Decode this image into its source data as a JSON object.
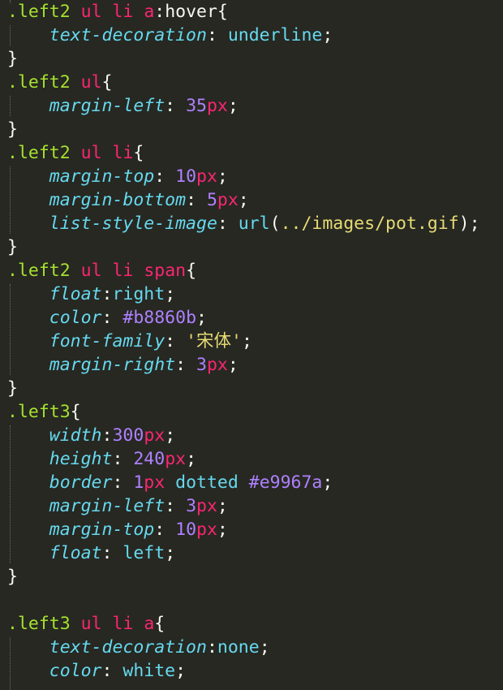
{
  "editor": {
    "colors": {
      "background": "#272822",
      "selector": "#a6e22e",
      "tag": "#f92672",
      "property": "#66d9ef",
      "number": "#ae81ff",
      "unit": "#f92672",
      "string": "#e6db74",
      "plain": "#f8f8f2"
    },
    "lines": [
      [
        [
          "sel",
          ".left2"
        ],
        [
          "plain",
          " "
        ],
        [
          "tag",
          "ul"
        ],
        [
          "plain",
          " "
        ],
        [
          "tag",
          "li"
        ],
        [
          "plain",
          " "
        ],
        [
          "tag",
          "a"
        ],
        [
          "plain",
          ":hover{"
        ]
      ],
      [
        [
          "plain",
          "    "
        ],
        [
          "prop",
          "text-decoration"
        ],
        [
          "plain",
          ": "
        ],
        [
          "val",
          "underline"
        ],
        [
          "plain",
          ";"
        ]
      ],
      [
        [
          "plain",
          "}"
        ]
      ],
      [
        [
          "sel",
          ".left2"
        ],
        [
          "plain",
          " "
        ],
        [
          "tag",
          "ul"
        ],
        [
          "plain",
          "{"
        ]
      ],
      [
        [
          "plain",
          "    "
        ],
        [
          "prop",
          "margin-left"
        ],
        [
          "plain",
          ": "
        ],
        [
          "num",
          "35"
        ],
        [
          "unit",
          "px"
        ],
        [
          "plain",
          ";"
        ]
      ],
      [
        [
          "plain",
          "}"
        ]
      ],
      [
        [
          "sel",
          ".left2"
        ],
        [
          "plain",
          " "
        ],
        [
          "tag",
          "ul"
        ],
        [
          "plain",
          " "
        ],
        [
          "tag",
          "li"
        ],
        [
          "plain",
          "{"
        ]
      ],
      [
        [
          "plain",
          "    "
        ],
        [
          "prop",
          "margin-top"
        ],
        [
          "plain",
          ": "
        ],
        [
          "num",
          "10"
        ],
        [
          "unit",
          "px"
        ],
        [
          "plain",
          ";"
        ]
      ],
      [
        [
          "plain",
          "    "
        ],
        [
          "prop",
          "margin-bottom"
        ],
        [
          "plain",
          ": "
        ],
        [
          "num",
          "5"
        ],
        [
          "unit",
          "px"
        ],
        [
          "plain",
          ";"
        ]
      ],
      [
        [
          "plain",
          "    "
        ],
        [
          "prop",
          "list-style-image"
        ],
        [
          "plain",
          ": "
        ],
        [
          "val",
          "url"
        ],
        [
          "plain",
          "("
        ],
        [
          "str",
          "../images/pot.gif"
        ],
        [
          "plain",
          ");"
        ]
      ],
      [
        [
          "plain",
          "}"
        ]
      ],
      [
        [
          "sel",
          ".left2"
        ],
        [
          "plain",
          " "
        ],
        [
          "tag",
          "ul"
        ],
        [
          "plain",
          " "
        ],
        [
          "tag",
          "li"
        ],
        [
          "plain",
          " "
        ],
        [
          "tag",
          "span"
        ],
        [
          "plain",
          "{"
        ]
      ],
      [
        [
          "plain",
          "    "
        ],
        [
          "prop",
          "float"
        ],
        [
          "plain",
          ":"
        ],
        [
          "val",
          "right"
        ],
        [
          "plain",
          ";"
        ]
      ],
      [
        [
          "plain",
          "    "
        ],
        [
          "prop",
          "color"
        ],
        [
          "plain",
          ": "
        ],
        [
          "num",
          "#b8860b"
        ],
        [
          "plain",
          ";"
        ]
      ],
      [
        [
          "plain",
          "    "
        ],
        [
          "prop",
          "font-family"
        ],
        [
          "plain",
          ": "
        ],
        [
          "str",
          "'宋体'"
        ],
        [
          "plain",
          ";"
        ]
      ],
      [
        [
          "plain",
          "    "
        ],
        [
          "prop",
          "margin-right"
        ],
        [
          "plain",
          ": "
        ],
        [
          "num",
          "3"
        ],
        [
          "unit",
          "px"
        ],
        [
          "plain",
          ";"
        ]
      ],
      [
        [
          "plain",
          "}"
        ]
      ],
      [
        [
          "sel",
          ".left3"
        ],
        [
          "plain",
          "{"
        ]
      ],
      [
        [
          "plain",
          "    "
        ],
        [
          "prop",
          "width"
        ],
        [
          "plain",
          ":"
        ],
        [
          "num",
          "300"
        ],
        [
          "unit",
          "px"
        ],
        [
          "plain",
          ";"
        ]
      ],
      [
        [
          "plain",
          "    "
        ],
        [
          "prop",
          "height"
        ],
        [
          "plain",
          ": "
        ],
        [
          "num",
          "240"
        ],
        [
          "unit",
          "px"
        ],
        [
          "plain",
          ";"
        ]
      ],
      [
        [
          "plain",
          "    "
        ],
        [
          "prop",
          "border"
        ],
        [
          "plain",
          ": "
        ],
        [
          "num",
          "1"
        ],
        [
          "unit",
          "px"
        ],
        [
          "plain",
          " "
        ],
        [
          "val",
          "dotted"
        ],
        [
          "plain",
          " "
        ],
        [
          "num",
          "#e9967a"
        ],
        [
          "plain",
          ";"
        ]
      ],
      [
        [
          "plain",
          "    "
        ],
        [
          "prop",
          "margin-left"
        ],
        [
          "plain",
          ": "
        ],
        [
          "num",
          "3"
        ],
        [
          "unit",
          "px"
        ],
        [
          "plain",
          ";"
        ]
      ],
      [
        [
          "plain",
          "    "
        ],
        [
          "prop",
          "margin-top"
        ],
        [
          "plain",
          ": "
        ],
        [
          "num",
          "10"
        ],
        [
          "unit",
          "px"
        ],
        [
          "plain",
          ";"
        ]
      ],
      [
        [
          "plain",
          "    "
        ],
        [
          "prop",
          "float"
        ],
        [
          "plain",
          ": "
        ],
        [
          "val",
          "left"
        ],
        [
          "plain",
          ";"
        ]
      ],
      [
        [
          "plain",
          "}"
        ]
      ],
      [],
      [
        [
          "sel",
          ".left3"
        ],
        [
          "plain",
          " "
        ],
        [
          "tag",
          "ul"
        ],
        [
          "plain",
          " "
        ],
        [
          "tag",
          "li"
        ],
        [
          "plain",
          " "
        ],
        [
          "tag",
          "a"
        ],
        [
          "plain",
          "{"
        ]
      ],
      [
        [
          "plain",
          "    "
        ],
        [
          "prop",
          "text-decoration"
        ],
        [
          "plain",
          ":"
        ],
        [
          "val",
          "none"
        ],
        [
          "plain",
          ";"
        ]
      ],
      [
        [
          "plain",
          "    "
        ],
        [
          "prop",
          "color"
        ],
        [
          "plain",
          ": "
        ],
        [
          "val",
          "white"
        ],
        [
          "plain",
          ";"
        ]
      ]
    ]
  }
}
